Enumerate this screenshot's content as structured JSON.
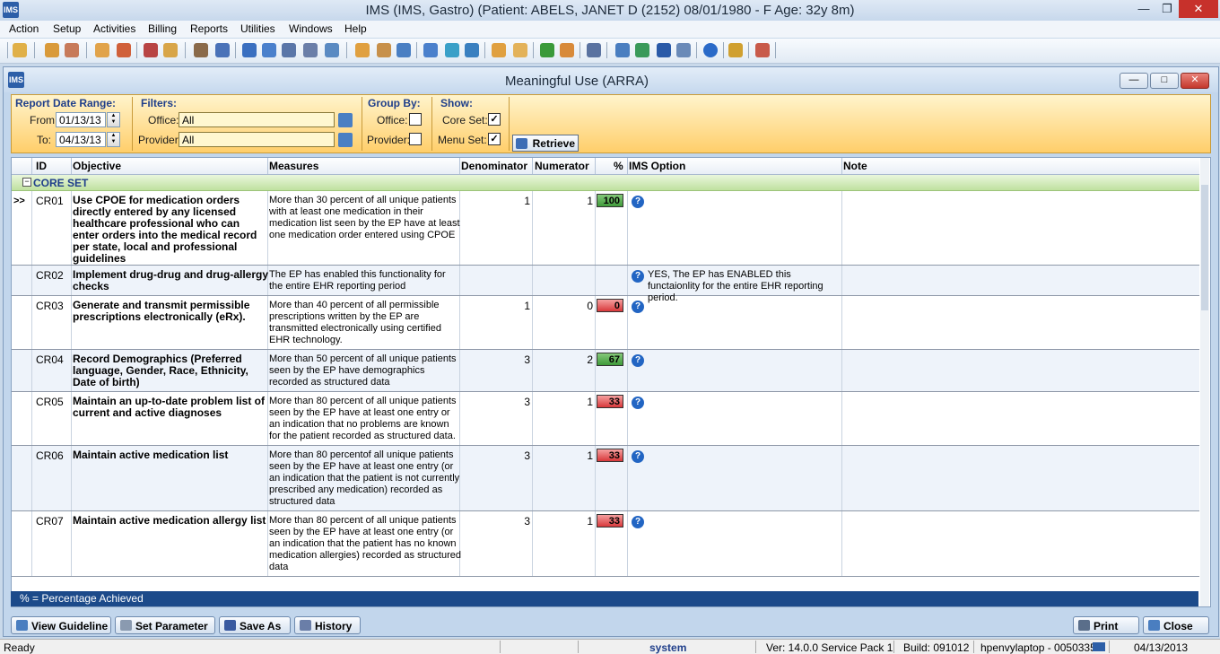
{
  "app": {
    "title": "IMS (IMS, Gastro)     (Patient: ABELS, JANET  D (2152) 08/01/1980 - F Age: 32y 8m)",
    "logo": "IMS"
  },
  "menu": [
    "Action",
    "Setup",
    "Activities",
    "Billing",
    "Reports",
    "Utilities",
    "Windows",
    "Help"
  ],
  "window": {
    "title": "Meaningful Use (ARRA)"
  },
  "filters": {
    "date_range_title": "Report Date Range:",
    "from_label": "From:",
    "from_value": "01/13/13",
    "to_label": "To:",
    "to_value": "04/13/13",
    "filters_title": "Filters:",
    "office_label": "Office:",
    "office_value": "All",
    "provider_label": "Provider:",
    "provider_value": "All",
    "group_title": "Group By:",
    "group_office_label": "Office:",
    "group_office_checked": false,
    "group_provider_label": "Provider:",
    "group_provider_checked": false,
    "show_title": "Show:",
    "core_set_label": "Core Set:",
    "core_set_checked": true,
    "menu_set_label": "Menu Set:",
    "menu_set_checked": true,
    "retrieve_label": "Retrieve"
  },
  "grid": {
    "columns": [
      "ID",
      "Objective",
      "Measures",
      "Denominator",
      "Numerator",
      "%",
      "IMS Option",
      "Note"
    ],
    "group_label": "CORE SET",
    "rows": [
      {
        "id": "CR01",
        "selected": ">>",
        "objective": "Use CPOE for medication orders directly entered by any licensed healthcare professional who can enter orders into the medical record per state, local and professional guidelines",
        "measure": "More than 30 percent of all unique patients with at least one medication in their medication list seen by the EP have at least one medication order entered using CPOE",
        "denominator": "1",
        "numerator": "1",
        "percent": "100",
        "status": "green",
        "option": ""
      },
      {
        "id": "CR02",
        "selected": "",
        "objective": "Implement drug-drug and drug-allergy checks",
        "measure": "The EP has enabled this functionality for the entire EHR reporting period",
        "denominator": "",
        "numerator": "",
        "percent": "",
        "status": "",
        "option": "YES, The EP has ENABLED this functaionlity for the entire EHR reporting period."
      },
      {
        "id": "CR03",
        "selected": "",
        "objective": "Generate and transmit permissible prescriptions electronically (eRx).",
        "measure": "More than 40 percent of all permissible prescriptions written by the EP are transmitted electronically using certified EHR technology.",
        "denominator": "1",
        "numerator": "0",
        "percent": "0",
        "status": "red",
        "option": ""
      },
      {
        "id": "CR04",
        "selected": "",
        "objective": "Record Demographics (Preferred language, Gender, Race, Ethnicity, Date of birth)",
        "measure": "More than 50 percent of all unique patients seen by the EP have demographics recorded as structured data",
        "denominator": "3",
        "numerator": "2",
        "percent": "67",
        "status": "green",
        "option": ""
      },
      {
        "id": "CR05",
        "selected": "",
        "objective": "Maintain an up-to-date problem list of current and active diagnoses",
        "measure": "More than 80 percent of all unique patients seen by the EP have at least one entry or an indication that no problems are known for the patient recorded as structured data.",
        "denominator": "3",
        "numerator": "1",
        "percent": "33",
        "status": "red",
        "option": ""
      },
      {
        "id": "CR06",
        "selected": "",
        "objective": "Maintain active medication list",
        "measure": "More than 80 percentof all unique patients seen by the EP have at least one entry (or an indication that the patient is not currently prescribed any medication) recorded as structured data",
        "denominator": "3",
        "numerator": "1",
        "percent": "33",
        "status": "red",
        "option": ""
      },
      {
        "id": "CR07",
        "selected": "",
        "objective": "Maintain active medication allergy list",
        "measure": "More than 80 percent of all unique patients seen by the EP have at least one entry (or an indication that the patient has no known medication allergies) recorded as structured data",
        "denominator": "3",
        "numerator": "1",
        "percent": "33",
        "status": "red",
        "option": ""
      }
    ],
    "footer_note": "% = Percentage Achieved"
  },
  "buttons": {
    "view_guideline": "View Guideline",
    "set_parameter": "Set Parameter",
    "save_as": "Save As",
    "history": "History",
    "print": "Print",
    "close": "Close"
  },
  "status": {
    "ready": "Ready",
    "user": "system",
    "version": "Ver: 14.0.0 Service Pack 1",
    "build": "Build: 091012",
    "machine": "hpenvylaptop - 0050335",
    "date": "04/13/2013"
  },
  "colors": {
    "pct_green": "#3f9a3a",
    "pct_red": "#d8383a",
    "header_blue": "#1f3e8a",
    "panel_orange": "#ffce6a"
  }
}
